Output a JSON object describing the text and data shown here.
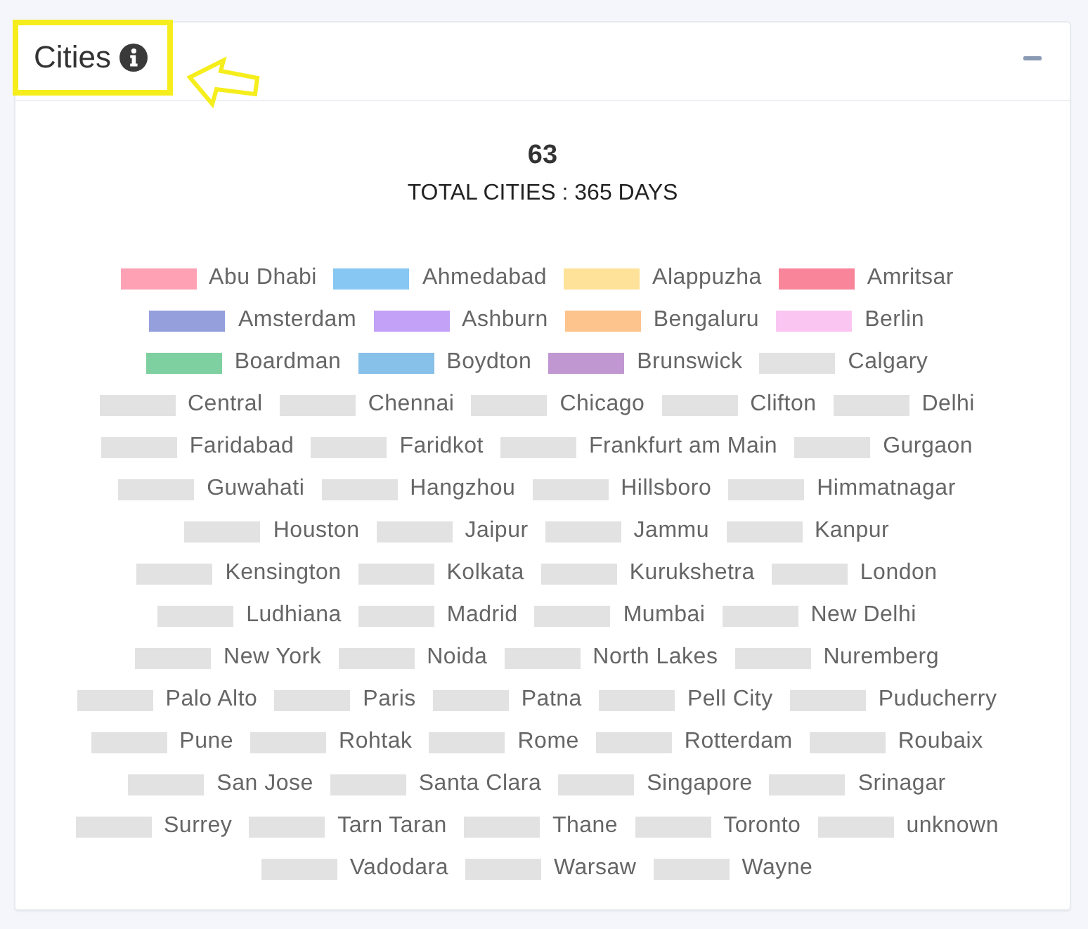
{
  "card": {
    "title": "Cities",
    "total": "63",
    "caption": "TOTAL CITIES : 365 DAYS",
    "legend_rows": [
      {
        "items": [
          {
            "label": "Abu Dhabi",
            "color": "#ffa1b4"
          },
          {
            "label": "Ahmedabad",
            "color": "#86c7f3"
          },
          {
            "label": "Alappuzha",
            "color": "#ffe29a"
          },
          {
            "label": "Amritsar",
            "color": "#f8859a"
          }
        ]
      },
      {
        "items": [
          {
            "label": "Amsterdam",
            "color": "#949fdc"
          },
          {
            "label": "Ashburn",
            "color": "#c2a1f7"
          },
          {
            "label": "Bengaluru",
            "color": "#fdc48e"
          },
          {
            "label": "Berlin",
            "color": "#fac6f1"
          }
        ]
      },
      {
        "items": [
          {
            "label": "Boardman",
            "color": "#7fd0a0"
          },
          {
            "label": "Boydton",
            "color": "#87c0e8"
          },
          {
            "label": "Brunswick",
            "color": "#c197d1"
          },
          {
            "label": "Calgary",
            "color": "#e2e2e2"
          }
        ]
      },
      {
        "items": [
          {
            "label": "Central",
            "color": "#e2e2e2"
          },
          {
            "label": "Chennai",
            "color": "#e2e2e2"
          },
          {
            "label": "Chicago",
            "color": "#e2e2e2"
          },
          {
            "label": "Clifton",
            "color": "#e2e2e2"
          },
          {
            "label": "Delhi",
            "color": "#e2e2e2"
          }
        ]
      },
      {
        "items": [
          {
            "label": "Faridabad",
            "color": "#e2e2e2"
          },
          {
            "label": "Faridkot",
            "color": "#e2e2e2"
          },
          {
            "label": "Frankfurt am Main",
            "color": "#e2e2e2"
          },
          {
            "label": "Gurgaon",
            "color": "#e2e2e2"
          }
        ]
      },
      {
        "items": [
          {
            "label": "Guwahati",
            "color": "#e2e2e2"
          },
          {
            "label": "Hangzhou",
            "color": "#e2e2e2"
          },
          {
            "label": "Hillsboro",
            "color": "#e2e2e2"
          },
          {
            "label": "Himmatnagar",
            "color": "#e2e2e2"
          }
        ]
      },
      {
        "items": [
          {
            "label": "Houston",
            "color": "#e2e2e2"
          },
          {
            "label": "Jaipur",
            "color": "#e2e2e2"
          },
          {
            "label": "Jammu",
            "color": "#e2e2e2"
          },
          {
            "label": "Kanpur",
            "color": "#e2e2e2"
          }
        ]
      },
      {
        "items": [
          {
            "label": "Kensington",
            "color": "#e2e2e2"
          },
          {
            "label": "Kolkata",
            "color": "#e2e2e2"
          },
          {
            "label": "Kurukshetra",
            "color": "#e2e2e2"
          },
          {
            "label": "London",
            "color": "#e2e2e2"
          }
        ]
      },
      {
        "items": [
          {
            "label": "Ludhiana",
            "color": "#e2e2e2"
          },
          {
            "label": "Madrid",
            "color": "#e2e2e2"
          },
          {
            "label": "Mumbai",
            "color": "#e2e2e2"
          },
          {
            "label": "New Delhi",
            "color": "#e2e2e2"
          }
        ]
      },
      {
        "items": [
          {
            "label": "New York",
            "color": "#e2e2e2"
          },
          {
            "label": "Noida",
            "color": "#e2e2e2"
          },
          {
            "label": "North Lakes",
            "color": "#e2e2e2"
          },
          {
            "label": "Nuremberg",
            "color": "#e2e2e2"
          }
        ]
      },
      {
        "items": [
          {
            "label": "Palo Alto",
            "color": "#e2e2e2"
          },
          {
            "label": "Paris",
            "color": "#e2e2e2"
          },
          {
            "label": "Patna",
            "color": "#e2e2e2"
          },
          {
            "label": "Pell City",
            "color": "#e2e2e2"
          },
          {
            "label": "Puducherry",
            "color": "#e2e2e2"
          }
        ]
      },
      {
        "items": [
          {
            "label": "Pune",
            "color": "#e2e2e2"
          },
          {
            "label": "Rohtak",
            "color": "#e2e2e2"
          },
          {
            "label": "Rome",
            "color": "#e2e2e2"
          },
          {
            "label": "Rotterdam",
            "color": "#e2e2e2"
          },
          {
            "label": "Roubaix",
            "color": "#e2e2e2"
          }
        ]
      },
      {
        "items": [
          {
            "label": "San Jose",
            "color": "#e2e2e2"
          },
          {
            "label": "Santa Clara",
            "color": "#e2e2e2"
          },
          {
            "label": "Singapore",
            "color": "#e2e2e2"
          },
          {
            "label": "Srinagar",
            "color": "#e2e2e2"
          }
        ]
      },
      {
        "items": [
          {
            "label": "Surrey",
            "color": "#e2e2e2"
          },
          {
            "label": "Tarn Taran",
            "color": "#e2e2e2"
          },
          {
            "label": "Thane",
            "color": "#e2e2e2"
          },
          {
            "label": "Toronto",
            "color": "#e2e2e2"
          },
          {
            "label": "unknown",
            "color": "#e2e2e2"
          }
        ]
      },
      {
        "items": [
          {
            "label": "Vadodara",
            "color": "#e2e2e2"
          },
          {
            "label": "Warsaw",
            "color": "#e2e2e2"
          },
          {
            "label": "Wayne",
            "color": "#e2e2e2"
          }
        ]
      }
    ]
  }
}
